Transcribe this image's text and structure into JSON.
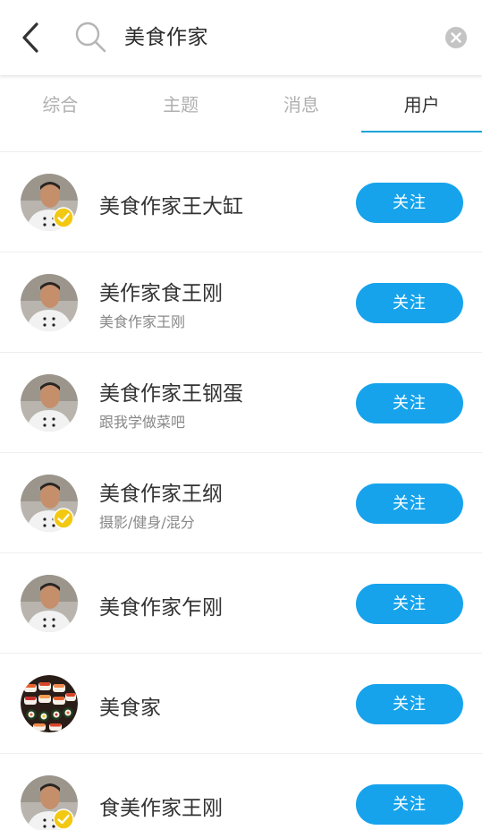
{
  "search": {
    "query": "美食作家"
  },
  "tabs": [
    {
      "label": "综合",
      "active": false
    },
    {
      "label": "主题",
      "active": false
    },
    {
      "label": "消息",
      "active": false
    },
    {
      "label": "用户",
      "active": true
    }
  ],
  "users": [
    {
      "name": "美食作家王大缸",
      "desc": "",
      "verified": true,
      "avatar": "chef-photo",
      "follow_label": "关注"
    },
    {
      "name": "美作家食王刚",
      "desc": "美食作家王刚",
      "verified": false,
      "avatar": "chef-photo",
      "follow_label": "关注"
    },
    {
      "name": "美食作家王钢蛋",
      "desc": "跟我学做菜吧",
      "verified": false,
      "avatar": "chef-photo",
      "follow_label": "关注"
    },
    {
      "name": "美食作家王纲",
      "desc": "摄影/健身/混分",
      "verified": true,
      "avatar": "chef-photo",
      "follow_label": "关注"
    },
    {
      "name": "美食作家乍刚",
      "desc": "",
      "verified": false,
      "avatar": "chef-photo",
      "follow_label": "关注"
    },
    {
      "name": "美食家",
      "desc": "",
      "verified": false,
      "avatar": "sushi-photo",
      "follow_label": "关注"
    },
    {
      "name": "食美作家王刚",
      "desc": "",
      "verified": true,
      "avatar": "chef-photo",
      "follow_label": "关注"
    }
  ],
  "colors": {
    "accent": "#16a3ec",
    "tab_underline": "#1aa3d9",
    "verified_badge": "#f2c811"
  },
  "icons": {
    "back": "chevron-left-icon",
    "search": "search-icon",
    "clear": "clear-circle-icon",
    "verified": "verified-check-icon"
  }
}
